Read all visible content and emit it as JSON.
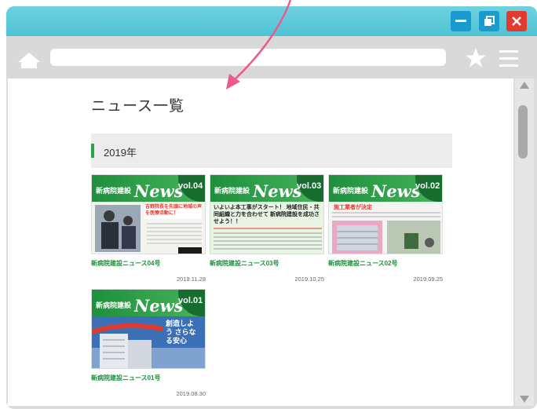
{
  "page": {
    "title": "ニュース一覧",
    "year": "2019年"
  },
  "cards": [
    {
      "series": "新病院建設",
      "brand": "News",
      "vol": "04",
      "label": "新病院建設ニュース04号",
      "date": "2019.11.28"
    },
    {
      "series": "新病院建設",
      "brand": "News",
      "vol": "03",
      "label": "新病院建設ニュース03号",
      "date": "2019.10.25"
    },
    {
      "series": "新病院建設",
      "brand": "News",
      "vol": "02",
      "label": "新病院建設ニュース02号",
      "date": "2019.09.25"
    },
    {
      "series": "新病院建設",
      "brand": "News",
      "vol": "01",
      "label": "新病院建設ニュース01号",
      "date": "2019.08.30"
    }
  ],
  "thumb_texts": {
    "t1": "吉野院長を先頭に地域の声を医療活動に！",
    "t2": "いよいよ本工事がスタート！ 地域住民・共同組織と力を合わせて 新病院建設を成功させよう！！",
    "t3": "施工業者が決定",
    "t4": "創造しよう さらなる安心"
  },
  "colors": {
    "titlebar": "#4ec3d3",
    "accent_green": "#1e8f3c",
    "close": "#e23a2e",
    "arrow": "#ec5a8c"
  }
}
